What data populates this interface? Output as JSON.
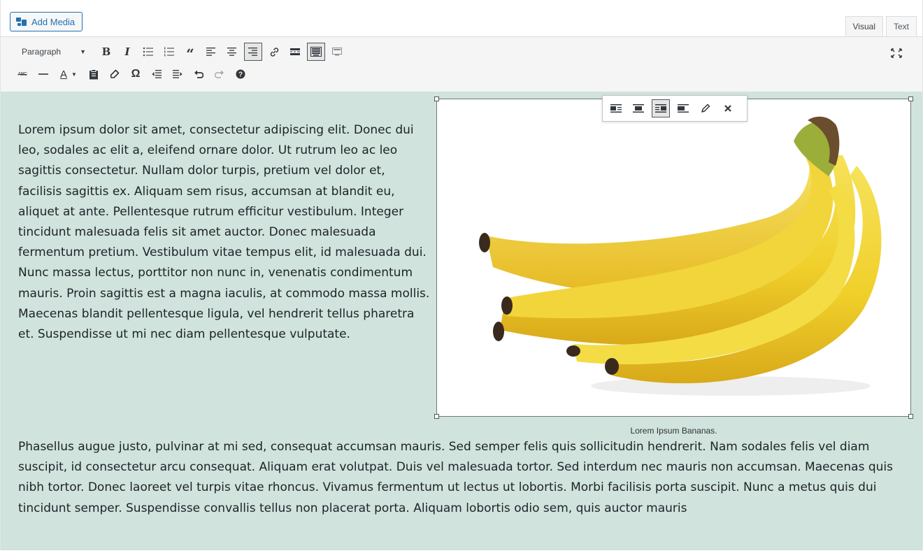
{
  "header": {
    "add_media_label": "Add Media",
    "add_media_icon": "add-media-icon",
    "tabs": [
      {
        "label": "Visual",
        "active": true
      },
      {
        "label": "Text",
        "active": false
      }
    ]
  },
  "toolbar": {
    "format_select_value": "Paragraph",
    "row1_buttons": [
      "bold",
      "italic",
      "bulleted-list",
      "numbered-list",
      "blockquote",
      "align-left",
      "align-center",
      "align-right",
      "insert-link",
      "read-more",
      "toolbar-toggle",
      "distraction-free"
    ],
    "row2_buttons": [
      "strikethrough",
      "horizontal-line",
      "text-color",
      "paste-as-text",
      "clear-formatting",
      "special-character",
      "decrease-indent",
      "increase-indent",
      "undo",
      "redo",
      "keyboard-shortcuts"
    ],
    "text_color_glyph": "A",
    "accent_color": "#2271b1"
  },
  "content": {
    "background_color": "#d0e3dd",
    "paragraph1": "Lorem ipsum dolor sit amet, consectetur adipiscing elit. Donec dui leo, sodales ac elit a, eleifend ornare dolor. Ut rutrum leo ac leo sagittis consectetur. Nullam dolor turpis, pretium vel dolor et, facilisis sagittis ex. Aliquam sem risus, accumsan at blandit eu, aliquet at ante. Pellentesque rutrum efficitur vestibulum. Integer tincidunt malesuada felis sit amet auctor. Donec malesuada fermentum pretium. Vestibulum vitae tempus elit, id malesuada dui. Nunc massa lectus, porttitor non nunc in, venenatis condimentum mauris. Proin sagittis est a magna iaculis, at commodo massa mollis. Maecenas blandit pellentesque ligula, vel hendrerit tellus pharetra et. Suspendisse ut mi nec diam pellentesque vulputate.",
    "paragraph2": "Phasellus augue justo, pulvinar at mi sed, consequat accumsan mauris. Sed semper felis quis sollicitudin hendrerit. Nam sodales felis vel diam suscipit, id consectetur arcu consequat. Aliquam erat volutpat. Duis vel malesuada tortor. Sed interdum nec mauris non accumsan. Maecenas quis nibh tortor. Donec laoreet vel turpis vitae rhoncus. Vivamus fermentum ut lectus ut lobortis. Morbi facilisis porta suscipit. Nunc a metus quis dui tincidunt semper. Suspendisse convallis tellus non placerat porta. Aliquam lobortis odio sem, quis auctor mauris",
    "image": {
      "caption": "Lorem Ipsum Bananas.",
      "subject": "bunch of bananas",
      "toolbar_buttons": [
        "align-left",
        "align-center",
        "align-right",
        "align-none",
        "edit",
        "remove"
      ],
      "selected_alignment": "align-right"
    }
  }
}
